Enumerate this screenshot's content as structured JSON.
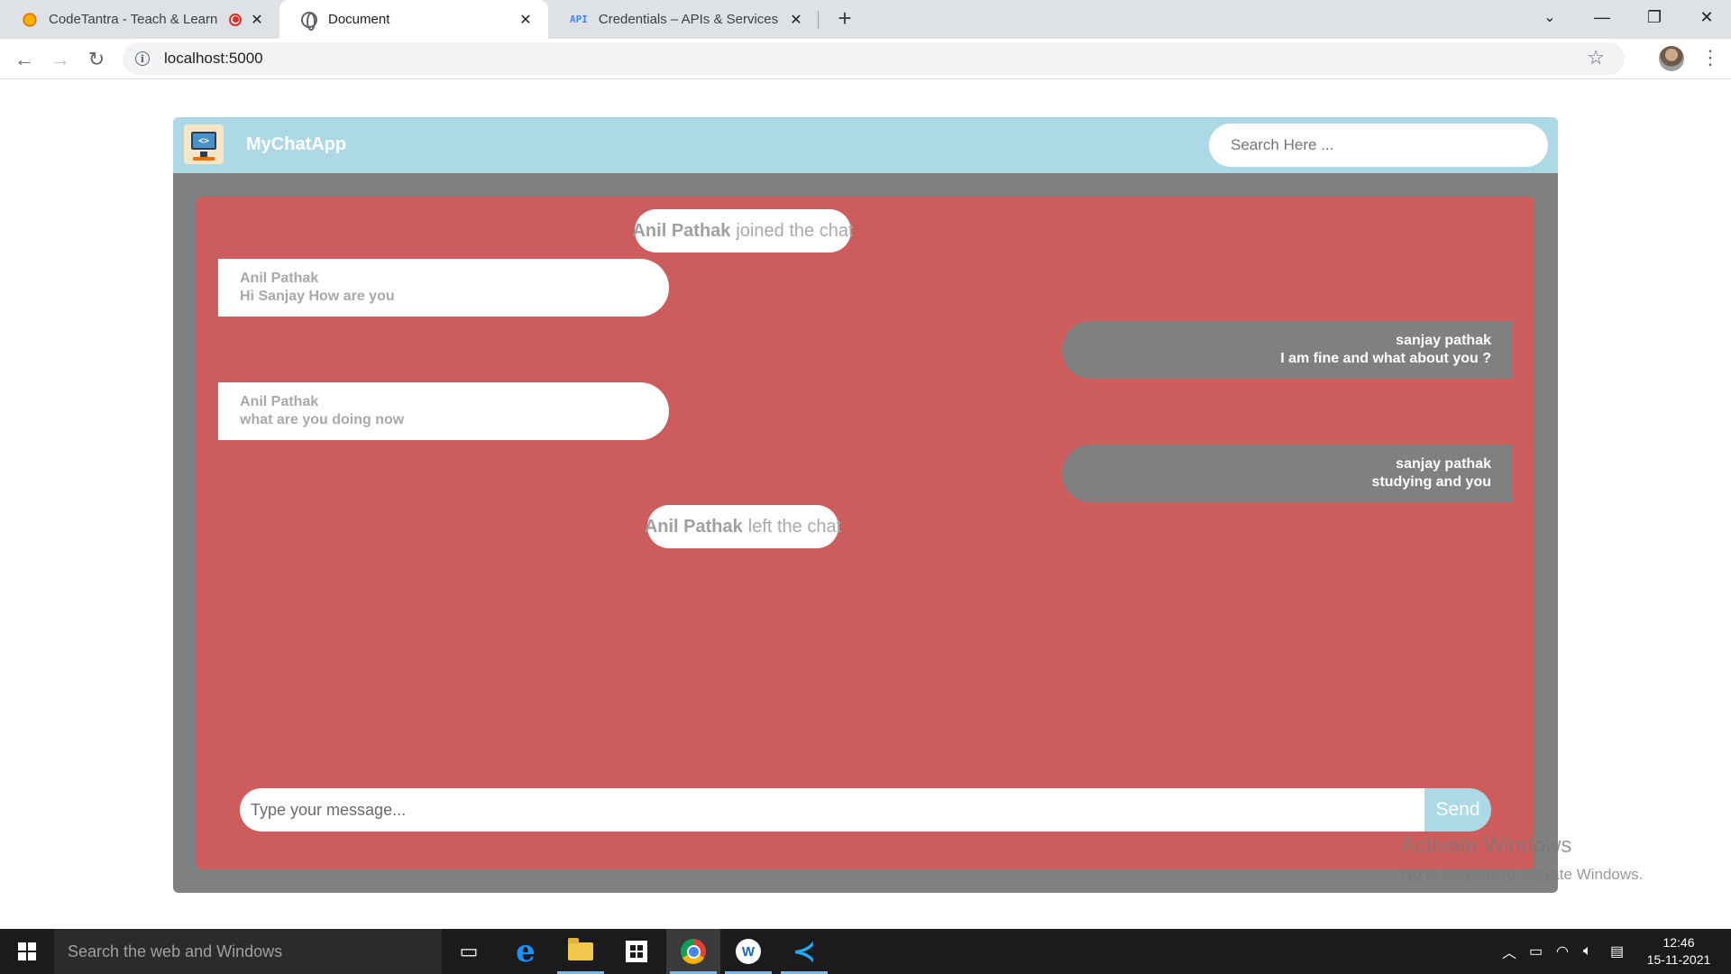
{
  "browser": {
    "tabs": [
      {
        "title": "CodeTantra - Teach & Learn",
        "icon": "codetantra-sun-icon",
        "active": false,
        "recording": true
      },
      {
        "title": "Document",
        "icon": "globe-icon",
        "active": true
      },
      {
        "title": "Credentials – APIs & Services – M",
        "icon": "api-icon",
        "active": false
      }
    ],
    "favicon_api_text": "API",
    "url": "localhost:5000"
  },
  "app": {
    "title": "MyChatApp",
    "logo_text": "<>",
    "search_placeholder": "Search Here ...",
    "colors": {
      "header": "#add8e6",
      "frame": "#808080",
      "chat_background": "#cd5c5c",
      "incoming_bubble": "#ffffff",
      "outgoing_bubble": "#808080",
      "send_button": "#add8e6"
    },
    "notices": [
      {
        "name": "Anil Pathak",
        "text": "joined the chat"
      },
      {
        "name": "Anil Pathak",
        "text": "left the chat"
      }
    ],
    "messages": [
      {
        "direction": "incoming",
        "sender": "Anil Pathak",
        "text": "Hi Sanjay How are you"
      },
      {
        "direction": "outgoing",
        "sender": "sanjay pathak",
        "text": "I am fine and what about you ?"
      },
      {
        "direction": "incoming",
        "sender": "Anil Pathak",
        "text": "what are you doing now"
      },
      {
        "direction": "outgoing",
        "sender": "sanjay pathak",
        "text": "studying and you"
      }
    ],
    "composer": {
      "placeholder": "Type your message...",
      "value": "",
      "send_label": "Send"
    }
  },
  "watermark": {
    "line1": "Activate Windows",
    "line2": "Go to Settings to activate Windows."
  },
  "taskbar": {
    "search_placeholder": "Search the web and Windows",
    "time": "12:46",
    "date": "15-11-2021",
    "pinned": [
      "task-view-icon",
      "edge-icon",
      "file-explorer-icon",
      "store-icon",
      "chrome-icon",
      "app-icon",
      "vscode-icon"
    ]
  }
}
